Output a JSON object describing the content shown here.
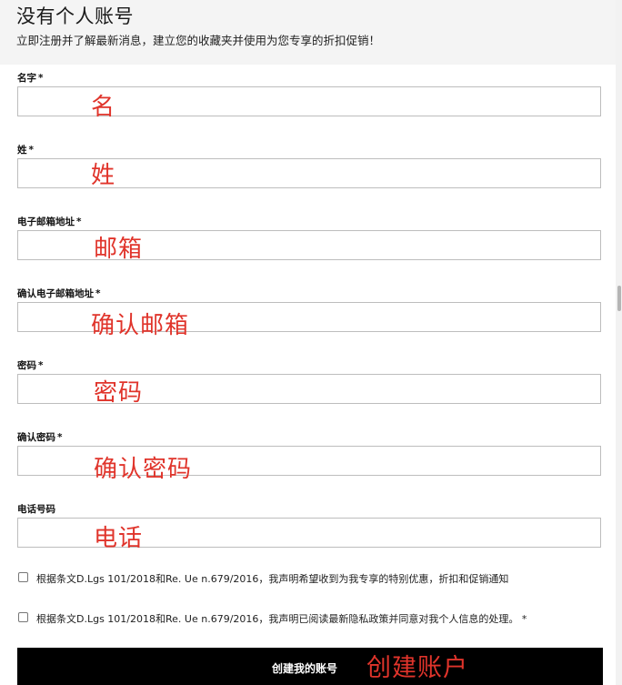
{
  "header": {
    "title": "没有个人账号",
    "subtitle": "立即注册并了解最新消息，建立您的收藏夹并使用为您专享的折扣促销！"
  },
  "fields": [
    {
      "label": "名字",
      "required": "*",
      "value": "",
      "annotation": "名"
    },
    {
      "label": "姓",
      "required": "*",
      "value": "",
      "annotation": "姓"
    },
    {
      "label": "电子邮箱地址",
      "required": "*",
      "value": "",
      "annotation": "邮箱"
    },
    {
      "label": "确认电子邮箱地址",
      "required": "*",
      "value": "",
      "annotation": "确认邮箱"
    },
    {
      "label": "密码",
      "required": "*",
      "value": "",
      "annotation": "密码"
    },
    {
      "label": "确认密码",
      "required": "*",
      "value": "",
      "annotation": "确认密码"
    },
    {
      "label": "电话号码",
      "required": "",
      "value": "",
      "annotation": "电话"
    }
  ],
  "consents": [
    {
      "text": "根据条文D.Lgs 101/2018和Re. Ue n.679/2016，我声明希望收到为我专享的特别优惠，折扣和促销通知",
      "checked": false
    },
    {
      "text": "根据条文D.Lgs 101/2018和Re. Ue n.679/2016，我声明已阅读最新隐私政策并同意对我个人信息的处理。 *",
      "checked": false
    }
  ],
  "submit": {
    "label": "创建我的账号",
    "annotation": "创建账户"
  },
  "colors": {
    "annotation": "#e0342b",
    "button_bg": "#000000",
    "header_bg": "#f4f4f4"
  }
}
